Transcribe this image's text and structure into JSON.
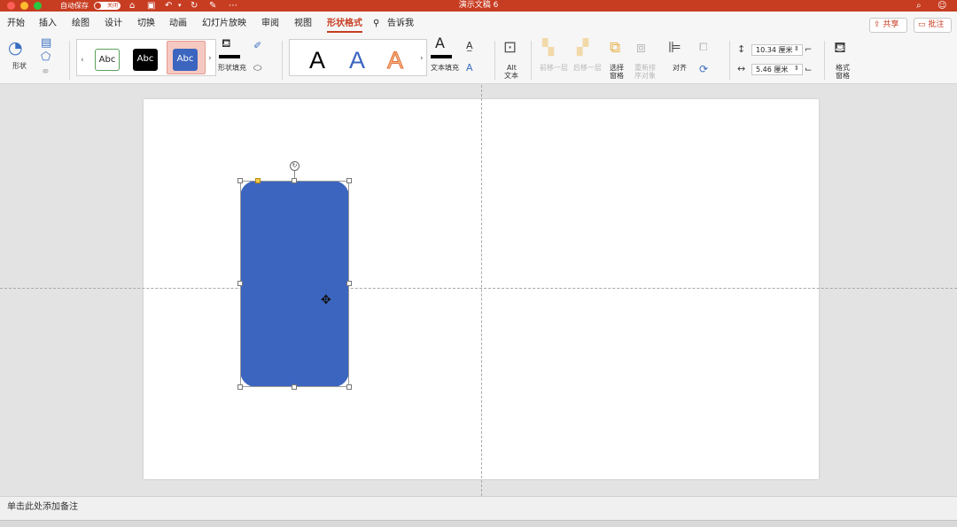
{
  "window": {
    "autosave_label": "自动保存",
    "autosave_state": "关闭",
    "title": "演示文稿 6"
  },
  "tabs": [
    {
      "label": "开始"
    },
    {
      "label": "插入"
    },
    {
      "label": "绘图"
    },
    {
      "label": "设计"
    },
    {
      "label": "切换"
    },
    {
      "label": "动画"
    },
    {
      "label": "幻灯片放映"
    },
    {
      "label": "审阅"
    },
    {
      "label": "视图"
    },
    {
      "label": "形状格式"
    }
  ],
  "tell_me": "告诉我",
  "share_label": "共享",
  "comment_label": "批注",
  "ribbon": {
    "shapes_label": "形状",
    "style_sample": "Abc",
    "shape_fill_label": "形状填充",
    "wordart_letter": "A",
    "text_fill_label": "文本填充",
    "alt_text_line1": "Alt",
    "alt_text_line2": "文本",
    "bring_forward_label": "前移一层",
    "send_backward_label": "后移一层",
    "selection_pane_line1": "选择",
    "selection_pane_line2": "窗格",
    "reorder_line1": "重新排",
    "reorder_line2": "序对象",
    "align_label": "对齐",
    "height_value": "10.34 厘米",
    "width_value": "5.46 厘米",
    "format_pane_line1": "格式",
    "format_pane_line2": "窗格"
  },
  "colors": {
    "accent": "#c73d22",
    "shape_fill": "#3c65bf"
  },
  "notes_placeholder": "单击此处添加备注"
}
